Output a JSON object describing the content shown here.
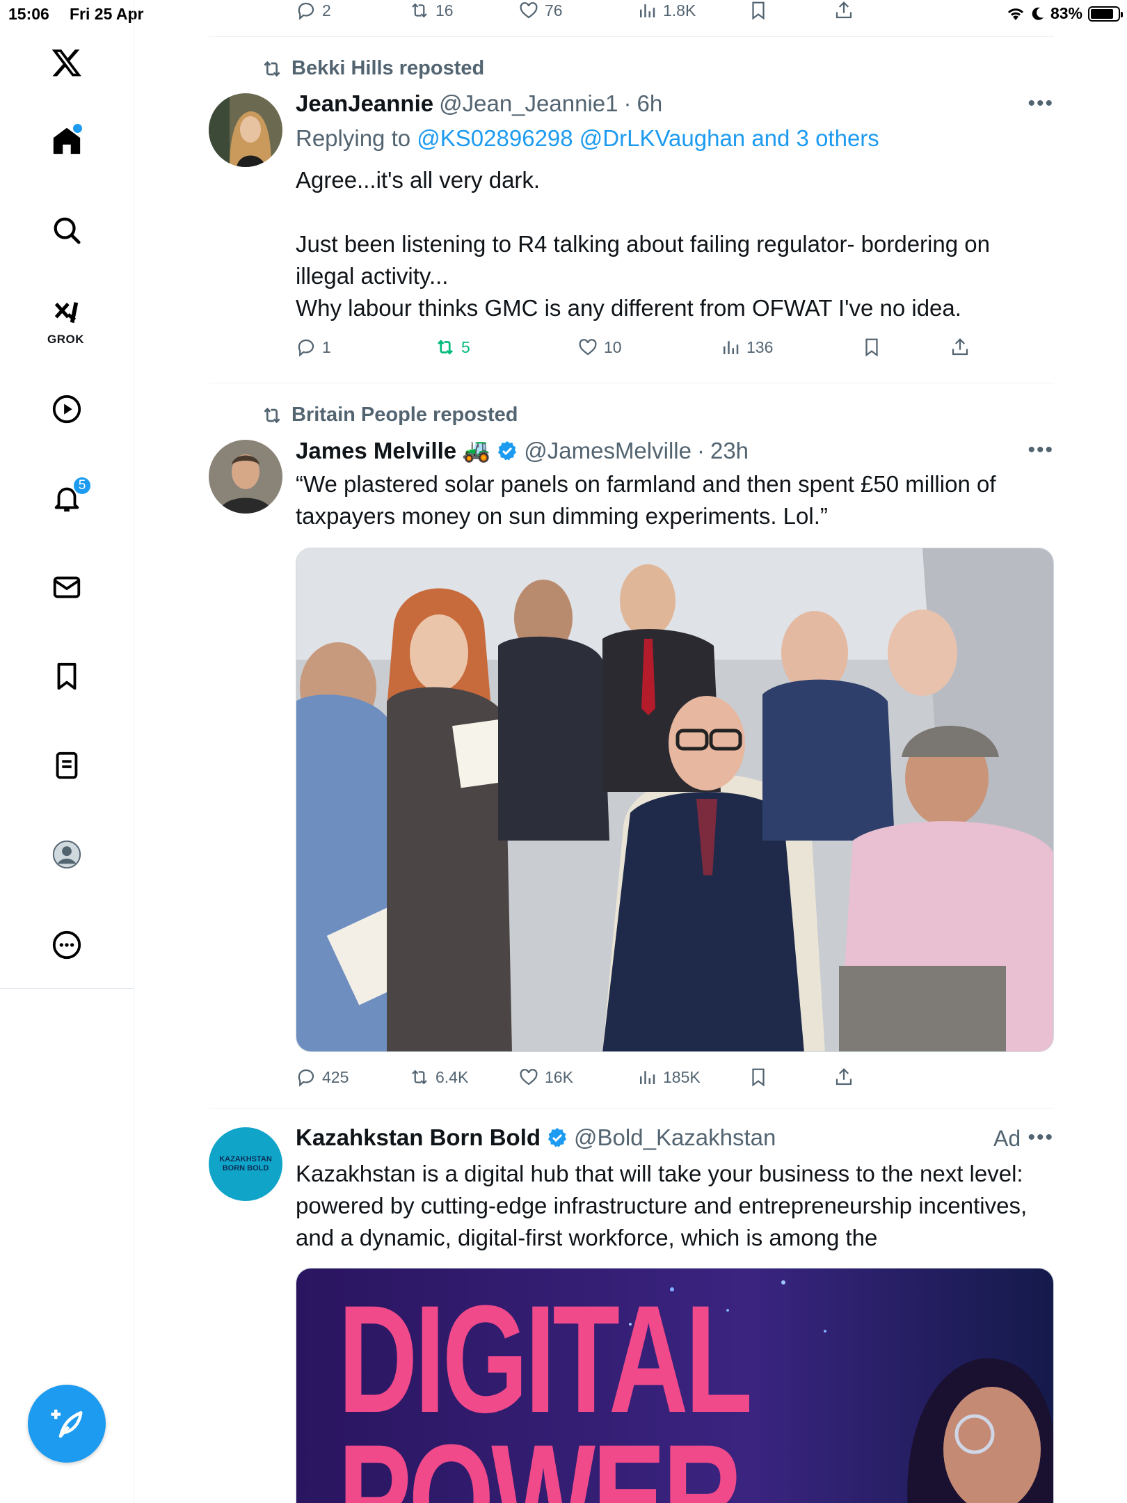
{
  "status_bar": {
    "time": "15:06",
    "date": "Fri 25 Apr",
    "battery": "83%"
  },
  "sidebar": {
    "items": [
      {
        "name": "x-logo"
      },
      {
        "name": "home"
      },
      {
        "name": "search"
      },
      {
        "name": "grok",
        "label": "GROK"
      },
      {
        "name": "video"
      },
      {
        "name": "notifications",
        "badge": "5"
      },
      {
        "name": "messages"
      },
      {
        "name": "bookmarks"
      },
      {
        "name": "lists"
      },
      {
        "name": "profile"
      },
      {
        "name": "more"
      }
    ]
  },
  "top_actions": {
    "replies": "2",
    "reposts": "16",
    "likes": "76",
    "views": "1.8K"
  },
  "tweets": [
    {
      "reposted_by": "Bekki Hills reposted",
      "name": "JeanJeannie",
      "handle": "@Jean_Jeannie1",
      "time": "6h",
      "replying_prefix": "Replying to",
      "replying_to": "@KS02896298 @DrLKVaughan and 3 others",
      "text": "Agree...it's all very dark.\n\nJust been listening to R4 talking about failing regulator- bordering on illegal activity...\nWhy labour thinks GMC is any different from OFWAT I've no idea.",
      "replies": "1",
      "reposts": "5",
      "likes": "10",
      "views": "136"
    },
    {
      "reposted_by": "Britain People reposted",
      "name": "James Melville",
      "emoji": "🚜",
      "handle": "@JamesMelville",
      "time": "23h",
      "text": "“We plastered solar panels on farmland and then spent £50 million of taxpayers money on sun dimming experiments. Lol.”",
      "replies": "425",
      "reposts": "6.4K",
      "likes": "16K",
      "views": "185K"
    },
    {
      "name": "Kazahkstan Born Bold",
      "handle": "@Bold_Kazakhstan",
      "ad": "Ad",
      "avatar_text": "KAZAKHSTAN BORN BOLD",
      "text": "Kazakhstan is a digital hub that will take your business to the next level: powered by cutting-edge infrastructure and entrepreneurship incentives, and a dynamic, digital-first workforce, which is among the",
      "ad_image_text": "DIGITAL POWER"
    }
  ],
  "separator": "·",
  "colors": {
    "accent": "#1d9bf0",
    "text": "#0f1419",
    "muted": "#536471",
    "repost_green": "#00ba7c"
  }
}
